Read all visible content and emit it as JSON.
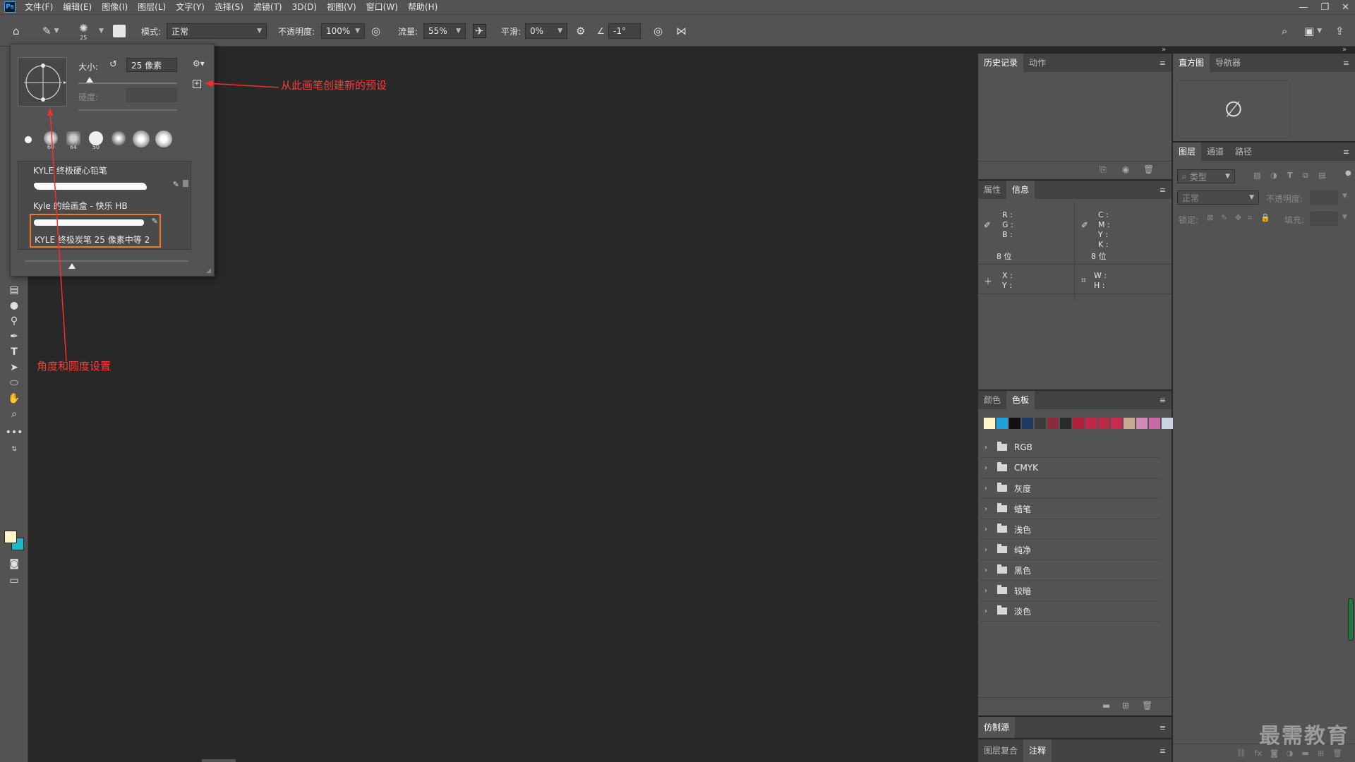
{
  "menu": [
    "文件(F)",
    "编辑(E)",
    "图像(I)",
    "图层(L)",
    "文字(Y)",
    "选择(S)",
    "滤镜(T)",
    "3D(D)",
    "视图(V)",
    "窗口(W)",
    "帮助(H)"
  ],
  "logo": "Ps",
  "window_controls": {
    "minimize": "—",
    "restore": "❐",
    "close": "✕"
  },
  "options": {
    "brush_size_badge": "25",
    "mode_label": "模式:",
    "mode_value": "正常",
    "opacity_label": "不透明度:",
    "opacity_value": "100%",
    "flow_label": "流量:",
    "flow_value": "55%",
    "smooth_label": "平滑:",
    "smooth_value": "0%",
    "angle_value": "-1°"
  },
  "brush_popup": {
    "size_label": "大小:",
    "size_value": "25 像素",
    "hardness_label": "硬度:",
    "tips": [
      "",
      "60",
      "84",
      "50",
      "",
      ""
    ],
    "brushes": [
      {
        "name": "KYLE 终极硬心铅笔"
      },
      {
        "name": "Kyle 的绘画盒 - 快乐 HB"
      },
      {
        "name": "KYLE 终极炭笔 25 像素中等 2"
      }
    ]
  },
  "annotations": {
    "new_preset": "从此画笔创建新的预设",
    "angle_roundness": "角度和圆度设置"
  },
  "history_panel": {
    "tabs": [
      "历史记录",
      "动作"
    ]
  },
  "info_panel": {
    "tabs": [
      "属性",
      "信息"
    ],
    "rgb": [
      "R :",
      "G :",
      "B :"
    ],
    "cmyk": [
      "C :",
      "M :",
      "Y :",
      "K :"
    ],
    "bits_left": "8 位",
    "bits_right": "8 位",
    "xy": [
      "X :",
      "Y :"
    ],
    "wh": [
      "W :",
      "H :"
    ]
  },
  "swatches_panel": {
    "tabs": [
      "颜色",
      "色板"
    ],
    "colors": [
      "#fff6c8",
      "#1fa0e0",
      "#111111",
      "#1e3a5f",
      "#3c3c3c",
      "#8a2b3f",
      "#2a2a2a",
      "#b0203c",
      "#c0264a",
      "#b82a46",
      "#c82a50",
      "#c8a890",
      "#d08ab8",
      "#c86aa8",
      "#c8d4e0"
    ],
    "groups": [
      "RGB",
      "CMYK",
      "灰度",
      "蜡笔",
      "浅色",
      "纯净",
      "黑色",
      "较暗",
      "淡色"
    ]
  },
  "clone_panel": {
    "tab": "仿制源"
  },
  "bottom_panel": {
    "tabs": [
      "图层复合",
      "注释"
    ]
  },
  "histogram_panel": {
    "tabs": [
      "直方图",
      "导航器"
    ],
    "empty_symbol": "∅"
  },
  "layers_panel": {
    "tabs": [
      "图层",
      "通道",
      "路径"
    ],
    "search_placeholder": "类型",
    "blend_mode": "正常",
    "opacity_label": "不透明度:",
    "lock_label": "锁定:",
    "fill_label": "填充:"
  },
  "watermark": "最需教育"
}
